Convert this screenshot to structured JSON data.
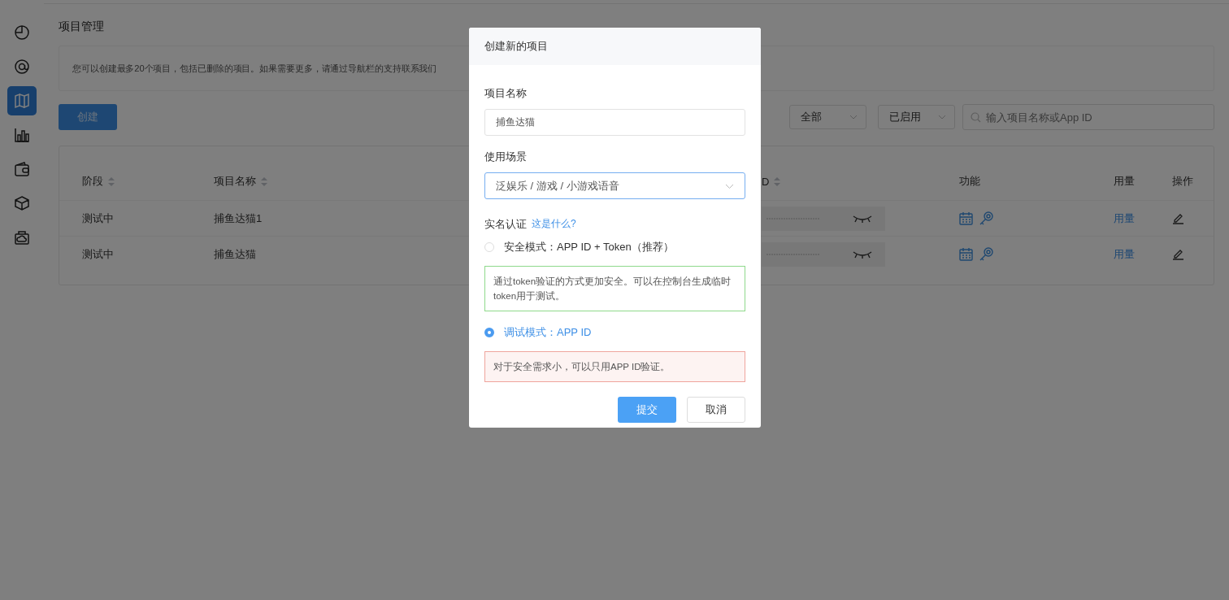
{
  "sidebar": {
    "items": [
      {
        "selected": false
      },
      {
        "selected": false
      },
      {
        "selected": true
      },
      {
        "selected": false
      },
      {
        "selected": false
      },
      {
        "selected": false
      },
      {
        "selected": false
      }
    ]
  },
  "page": {
    "title": "项目管理",
    "notice": "您可以创建最多20个项目，包括已删除的项目。如果需要更多，请通过导航栏的支持联系我们",
    "create_button": "创建",
    "filters": [
      {
        "value": "全部"
      },
      {
        "value": "已启用"
      }
    ],
    "search": {
      "placeholder": "输入项目名称或App ID"
    }
  },
  "table": {
    "columns": [
      {
        "label": "阶段",
        "sortable": true
      },
      {
        "label": "项目名称",
        "sortable": true
      },
      {
        "label": "D",
        "sortable": true
      },
      {
        "label": "功能",
        "sortable": false
      },
      {
        "label": "用量",
        "sortable": false
      },
      {
        "label": "操作",
        "sortable": false
      }
    ],
    "rows": [
      {
        "stage": "测试中",
        "name": "捕鱼达猫1",
        "usage": "用量"
      },
      {
        "stage": "测试中",
        "name": "捕鱼达猫",
        "usage": "用量"
      }
    ]
  },
  "dialog": {
    "title": "创建新的项目",
    "name_label": "项目名称",
    "name_value": "捕鱼达猫",
    "scene_label": "使用场景",
    "scene_value": "泛娱乐 / 游戏 / 小游戏语音",
    "auth_label": "实名认证",
    "auth_help": "这是什么?",
    "options": [
      {
        "label": "安全模式：APP ID + Token（推荐）",
        "selected": false,
        "kind": "success",
        "description": "通过token验证的方式更加安全。可以在控制台生成临时token用于测试。"
      },
      {
        "label": "调试模式：APP ID",
        "selected": true,
        "kind": "danger",
        "description": "对于安全需求小，可以只用APP ID验证。"
      }
    ],
    "buttons": [
      {
        "label": "提交",
        "kind": "primary"
      },
      {
        "label": "取消",
        "kind": "default"
      }
    ]
  }
}
